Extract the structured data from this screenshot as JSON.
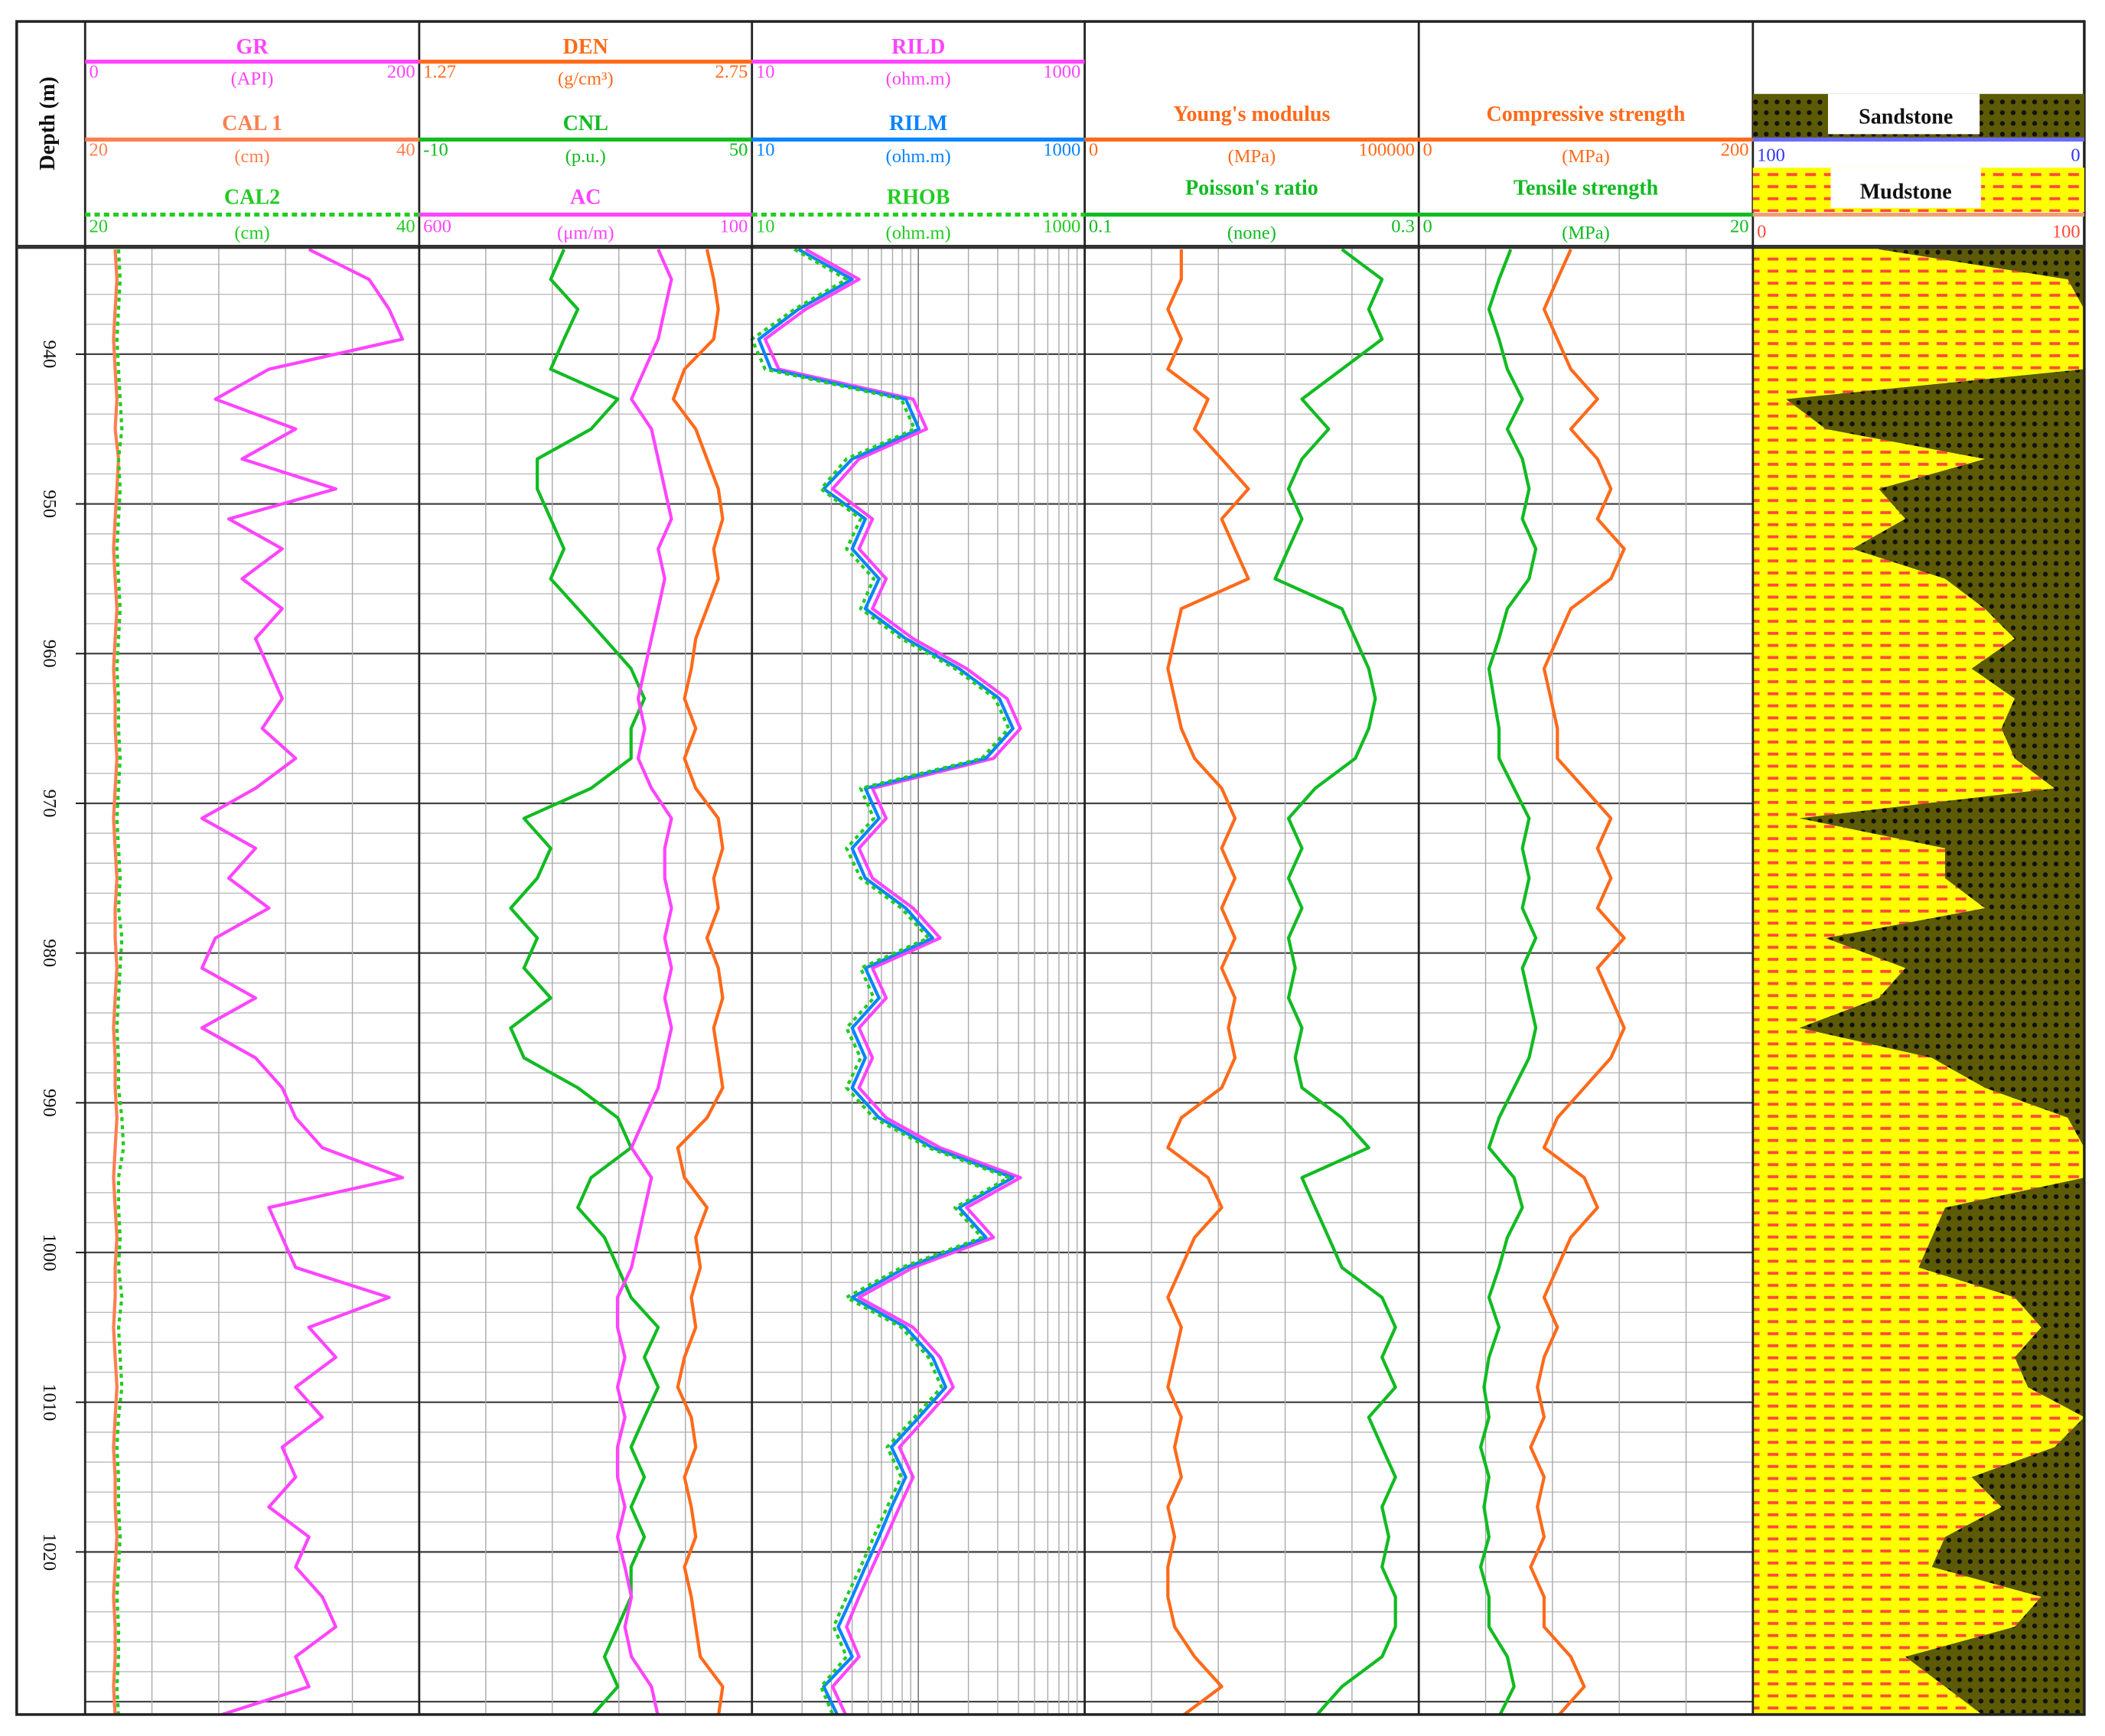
{
  "chart_data": {
    "type": "line",
    "title": "",
    "depth": {
      "label": "Depth (m)",
      "range": [
        933,
        1031
      ],
      "ticks": [
        940,
        950,
        960,
        970,
        980,
        990,
        1000,
        1010,
        1020
      ],
      "values": [
        933,
        935,
        937,
        939,
        941,
        943,
        945,
        947,
        949,
        951,
        953,
        955,
        957,
        959,
        961,
        963,
        965,
        967,
        969,
        971,
        973,
        975,
        977,
        979,
        981,
        983,
        985,
        987,
        989,
        991,
        993,
        995,
        997,
        999,
        1001,
        1003,
        1005,
        1007,
        1009,
        1011,
        1013,
        1015,
        1017,
        1019,
        1021,
        1023,
        1025,
        1027,
        1029,
        1031
      ]
    },
    "tracks": [
      {
        "curves": [
          {
            "name": "GR",
            "unit": "(API)",
            "min": 0,
            "max": 200,
            "scale": "linear",
            "color": "#ff44ff",
            "style": "solid",
            "values": [
              134,
              170,
              182,
              190,
              110,
              78,
              126,
              94,
              150,
              86,
              118,
              94,
              118,
              102,
              110,
              118,
              106,
              126,
              102,
              70,
              102,
              86,
              110,
              78,
              70,
              102,
              70,
              102,
              118,
              126,
              142,
              190,
              110,
              118,
              126,
              182,
              134,
              150,
              126,
              142,
              118,
              126,
              110,
              134,
              126,
              142,
              150,
              126,
              134,
              78
            ]
          },
          {
            "name": "CAL 1",
            "unit": "(cm)",
            "min": 20,
            "max": 40,
            "scale": "linear",
            "color": "#ff7f50",
            "style": "solid",
            "values": [
              21.8,
              21.9,
              21.8,
              21.7,
              21.8,
              21.9,
              21.8,
              22.0,
              21.9,
              21.8,
              21.7,
              21.8,
              21.9,
              21.8,
              21.7,
              21.8,
              21.8,
              21.9,
              21.8,
              21.7,
              21.8,
              21.9,
              21.8,
              21.8,
              21.9,
              21.8,
              21.7,
              21.8,
              21.8,
              21.9,
              21.8,
              21.7,
              21.8,
              21.9,
              21.8,
              21.8,
              21.7,
              21.8,
              21.9,
              21.8,
              21.7,
              21.8,
              21.8,
              21.9,
              21.8,
              21.7,
              21.8,
              21.8,
              21.7,
              21.8
            ]
          },
          {
            "name": "CAL2",
            "unit": "(cm)",
            "min": 20,
            "max": 40,
            "scale": "linear",
            "color": "#22cc22",
            "style": "dotted",
            "values": [
              22.0,
              22.1,
              22.0,
              21.9,
              22.0,
              22.1,
              22.2,
              22.0,
              22.1,
              22.0,
              21.9,
              22.0,
              22.1,
              22.0,
              21.9,
              22.0,
              22.0,
              22.1,
              22.0,
              21.9,
              22.0,
              22.1,
              22.0,
              22.2,
              22.1,
              22.0,
              21.9,
              22.0,
              22.0,
              22.2,
              22.3,
              22.0,
              22.0,
              22.1,
              22.0,
              22.2,
              22.0,
              22.1,
              22.2,
              22.0,
              21.9,
              22.0,
              22.0,
              22.1,
              22.0,
              21.9,
              22.0,
              22.0,
              21.9,
              22.0
            ]
          }
        ]
      },
      {
        "curves": [
          {
            "name": "DEN",
            "unit": "(g/cm³)",
            "min": 1.27,
            "max": 2.75,
            "scale": "linear",
            "color": "#ff6a1a",
            "style": "solid",
            "values": [
              2.55,
              2.58,
              2.6,
              2.58,
              2.45,
              2.4,
              2.5,
              2.55,
              2.6,
              2.62,
              2.58,
              2.6,
              2.55,
              2.5,
              2.48,
              2.45,
              2.5,
              2.45,
              2.5,
              2.6,
              2.62,
              2.58,
              2.6,
              2.55,
              2.6,
              2.62,
              2.58,
              2.6,
              2.62,
              2.55,
              2.42,
              2.45,
              2.55,
              2.5,
              2.52,
              2.48,
              2.5,
              2.45,
              2.42,
              2.48,
              2.5,
              2.45,
              2.48,
              2.5,
              2.45,
              2.48,
              2.5,
              2.52,
              2.62,
              2.6
            ]
          },
          {
            "name": "CNL",
            "unit": "(p.u.)",
            "min": -10,
            "max": 50,
            "scale": "linear",
            "color": "#11bb22",
            "style": "solid",
            "values": [
              16.1,
              13.7,
              18.6,
              16.1,
              13.7,
              25.8,
              21,
              11.3,
              11.3,
              13.7,
              16.1,
              13.7,
              18.6,
              23.4,
              28.2,
              30.6,
              28.2,
              28.2,
              21,
              8.9,
              13.7,
              11.3,
              6.5,
              11.3,
              8.9,
              13.7,
              6.5,
              8.9,
              18.6,
              25.8,
              28.2,
              21,
              18.6,
              23.4,
              25.8,
              28.2,
              33.1,
              30.6,
              33.1,
              30.6,
              28.2,
              30.6,
              28.2,
              30.6,
              28.2,
              28.2,
              25.8,
              23.4,
              25.8,
              21
            ]
          },
          {
            "name": "AC",
            "unit": "(μm/m)",
            "min": 600,
            "max": 100,
            "scale": "linear",
            "color": "#ff44ff",
            "style": "solid",
            "values": [
              241,
              221,
              231,
              241,
              261,
              281,
              251,
              241,
              231,
              221,
              241,
              231,
              241,
              251,
              261,
              271,
              261,
              271,
              251,
              221,
              231,
              231,
              221,
              231,
              221,
              231,
              221,
              231,
              241,
              261,
              281,
              251,
              261,
              271,
              281,
              302,
              302,
              291,
              302,
              291,
              302,
              302,
              291,
              302,
              291,
              281,
              291,
              281,
              251,
              241
            ]
          }
        ]
      },
      {
        "curves": [
          {
            "name": "RILD",
            "unit": "(ohm.m)",
            "min": 10,
            "max": 1000,
            "scale": "log",
            "color": "#ff44ff",
            "style": "solid",
            "values": [
              21,
              44,
              21,
              12,
              14.5,
              93,
              112,
              44,
              30.5,
              53,
              44,
              64,
              53,
              93,
              195,
              341,
              411,
              283,
              53,
              64,
              44,
              53,
              93,
              135,
              53,
              64,
              44,
              53,
              44,
              64,
              135,
              411,
              195,
              283,
              93,
              44,
              93,
              135,
              162,
              112,
              77,
              93,
              77,
              64,
              53,
              44,
              37,
              44,
              30.5,
              37
            ]
          },
          {
            "name": "RILM",
            "unit": "(ohm.m)",
            "min": 10,
            "max": 1000,
            "scale": "log",
            "color": "#0a84ff",
            "style": "solid",
            "values": [
              19,
              40,
              19,
              11,
              13,
              84,
              101,
              40,
              27,
              48,
              40,
              58,
              48,
              84,
              176,
              307,
              370,
              255,
              48,
              58,
              40,
              48,
              84,
              122,
              48,
              58,
              40,
              48,
              40,
              58,
              122,
              370,
              176,
              255,
              84,
              40,
              84,
              122,
              146,
              101,
              69,
              84,
              69,
              58,
              48,
              40,
              33,
              40,
              27,
              33
            ]
          },
          {
            "name": "RHOB",
            "unit": "(ohm.m)",
            "min": 10,
            "max": 1000,
            "scale": "log",
            "color": "#22cc22",
            "style": "dotted",
            "values": [
              18,
              37,
              18,
              10,
              12,
              79,
              95,
              37,
              26,
              45,
              37,
              54,
              45,
              79,
              166,
              290,
              349,
              241,
              45,
              54,
              37,
              45,
              79,
              115,
              45,
              54,
              37,
              45,
              37,
              54,
              115,
              349,
              166,
              241,
              79,
              37,
              79,
              115,
              138,
              95,
              65,
              79,
              65,
              54,
              45,
              37,
              31,
              37,
              26,
              31
            ]
          }
        ]
      },
      {
        "curves": [
          {
            "name": "Young's modulus",
            "unit": "(MPa)",
            "min": 0,
            "max": 100000,
            "scale": "linear",
            "color": "#ff6a1a",
            "style": "solid",
            "values": [
              28900,
              28900,
              24900,
              28900,
              24900,
              36900,
              32900,
              41000,
              49000,
              41000,
              45000,
              49000,
              28900,
              26900,
              24900,
              26900,
              28900,
              32900,
              41000,
              45000,
              41000,
              45000,
              41000,
              45000,
              41000,
              45000,
              43000,
              45000,
              41000,
              28900,
              24900,
              36900,
              41000,
              32900,
              28900,
              24900,
              28900,
              26900,
              24900,
              28900,
              26900,
              28900,
              24900,
              26900,
              24900,
              24900,
              26900,
              32900,
              41000,
              28900
            ]
          },
          {
            "name": "Poisson's ratio",
            "unit": "(none)",
            "min": 0.1,
            "max": 0.3,
            "scale": "linear",
            "color": "#11bb22",
            "style": "solid",
            "values": [
              0.254,
              0.278,
              0.27,
              0.278,
              0.254,
              0.23,
              0.246,
              0.23,
              0.222,
              0.23,
              0.222,
              0.214,
              0.254,
              0.262,
              0.27,
              0.274,
              0.27,
              0.262,
              0.238,
              0.222,
              0.23,
              0.222,
              0.23,
              0.222,
              0.226,
              0.222,
              0.23,
              0.226,
              0.23,
              0.254,
              0.27,
              0.23,
              0.238,
              0.246,
              0.254,
              0.278,
              0.286,
              0.278,
              0.286,
              0.27,
              0.278,
              0.286,
              0.278,
              0.282,
              0.278,
              0.286,
              0.286,
              0.278,
              0.254,
              0.238
            ]
          }
        ]
      },
      {
        "curves": [
          {
            "name": "Compressive strength",
            "unit": "(MPa)",
            "min": 0,
            "max": 200,
            "scale": "linear",
            "color": "#ff6a1a",
            "style": "solid",
            "values": [
              91,
              83,
              75,
              83,
              91,
              107,
              91,
              107,
              115,
              107,
              123,
              115,
              91,
              83,
              75,
              79,
              83,
              83,
              99,
              115,
              107,
              115,
              107,
              123,
              107,
              115,
              123,
              115,
              99,
              83,
              75,
              99,
              107,
              91,
              83,
              75,
              83,
              75,
              71,
              75,
              67,
              75,
              71,
              75,
              67,
              75,
              75,
              91,
              99,
              83
            ]
          },
          {
            "name": "Tensile strength",
            "unit": "(MPa)",
            "min": 0,
            "max": 20,
            "scale": "linear",
            "color": "#11bb22",
            "style": "solid",
            "values": [
              5.5,
              4.8,
              4.2,
              4.8,
              5.3,
              6.2,
              5.3,
              6.2,
              6.6,
              6.2,
              7.0,
              6.6,
              5.3,
              4.8,
              4.2,
              4.5,
              4.8,
              4.8,
              5.7,
              6.6,
              6.2,
              6.6,
              6.2,
              7.0,
              6.2,
              6.6,
              7.0,
              6.6,
              5.7,
              4.8,
              4.2,
              5.7,
              6.2,
              5.3,
              4.8,
              4.2,
              4.8,
              4.2,
              3.9,
              4.2,
              3.7,
              4.2,
              3.9,
              4.2,
              3.7,
              4.2,
              4.2,
              5.3,
              5.7,
              4.8
            ]
          }
        ]
      }
    ],
    "lithology": {
      "sandstone": {
        "name": "Sandstone",
        "min": 100,
        "max": 0,
        "color": "#5c5a05"
      },
      "mudstone": {
        "name": "Mudstone",
        "min": 0,
        "max": 100,
        "color": "#ffff00"
      },
      "mudstone_percent": [
        38,
        95,
        100,
        100,
        100,
        10,
        22,
        70,
        38,
        46,
        30,
        58,
        70,
        79,
        66,
        79,
        75,
        79,
        91,
        14,
        58,
        58,
        70,
        22,
        46,
        38,
        14,
        54,
        70,
        95,
        100,
        100,
        58,
        54,
        50,
        79,
        87,
        79,
        83,
        100,
        91,
        66,
        75,
        58,
        54,
        87,
        79,
        46,
        58,
        70
      ]
    }
  }
}
